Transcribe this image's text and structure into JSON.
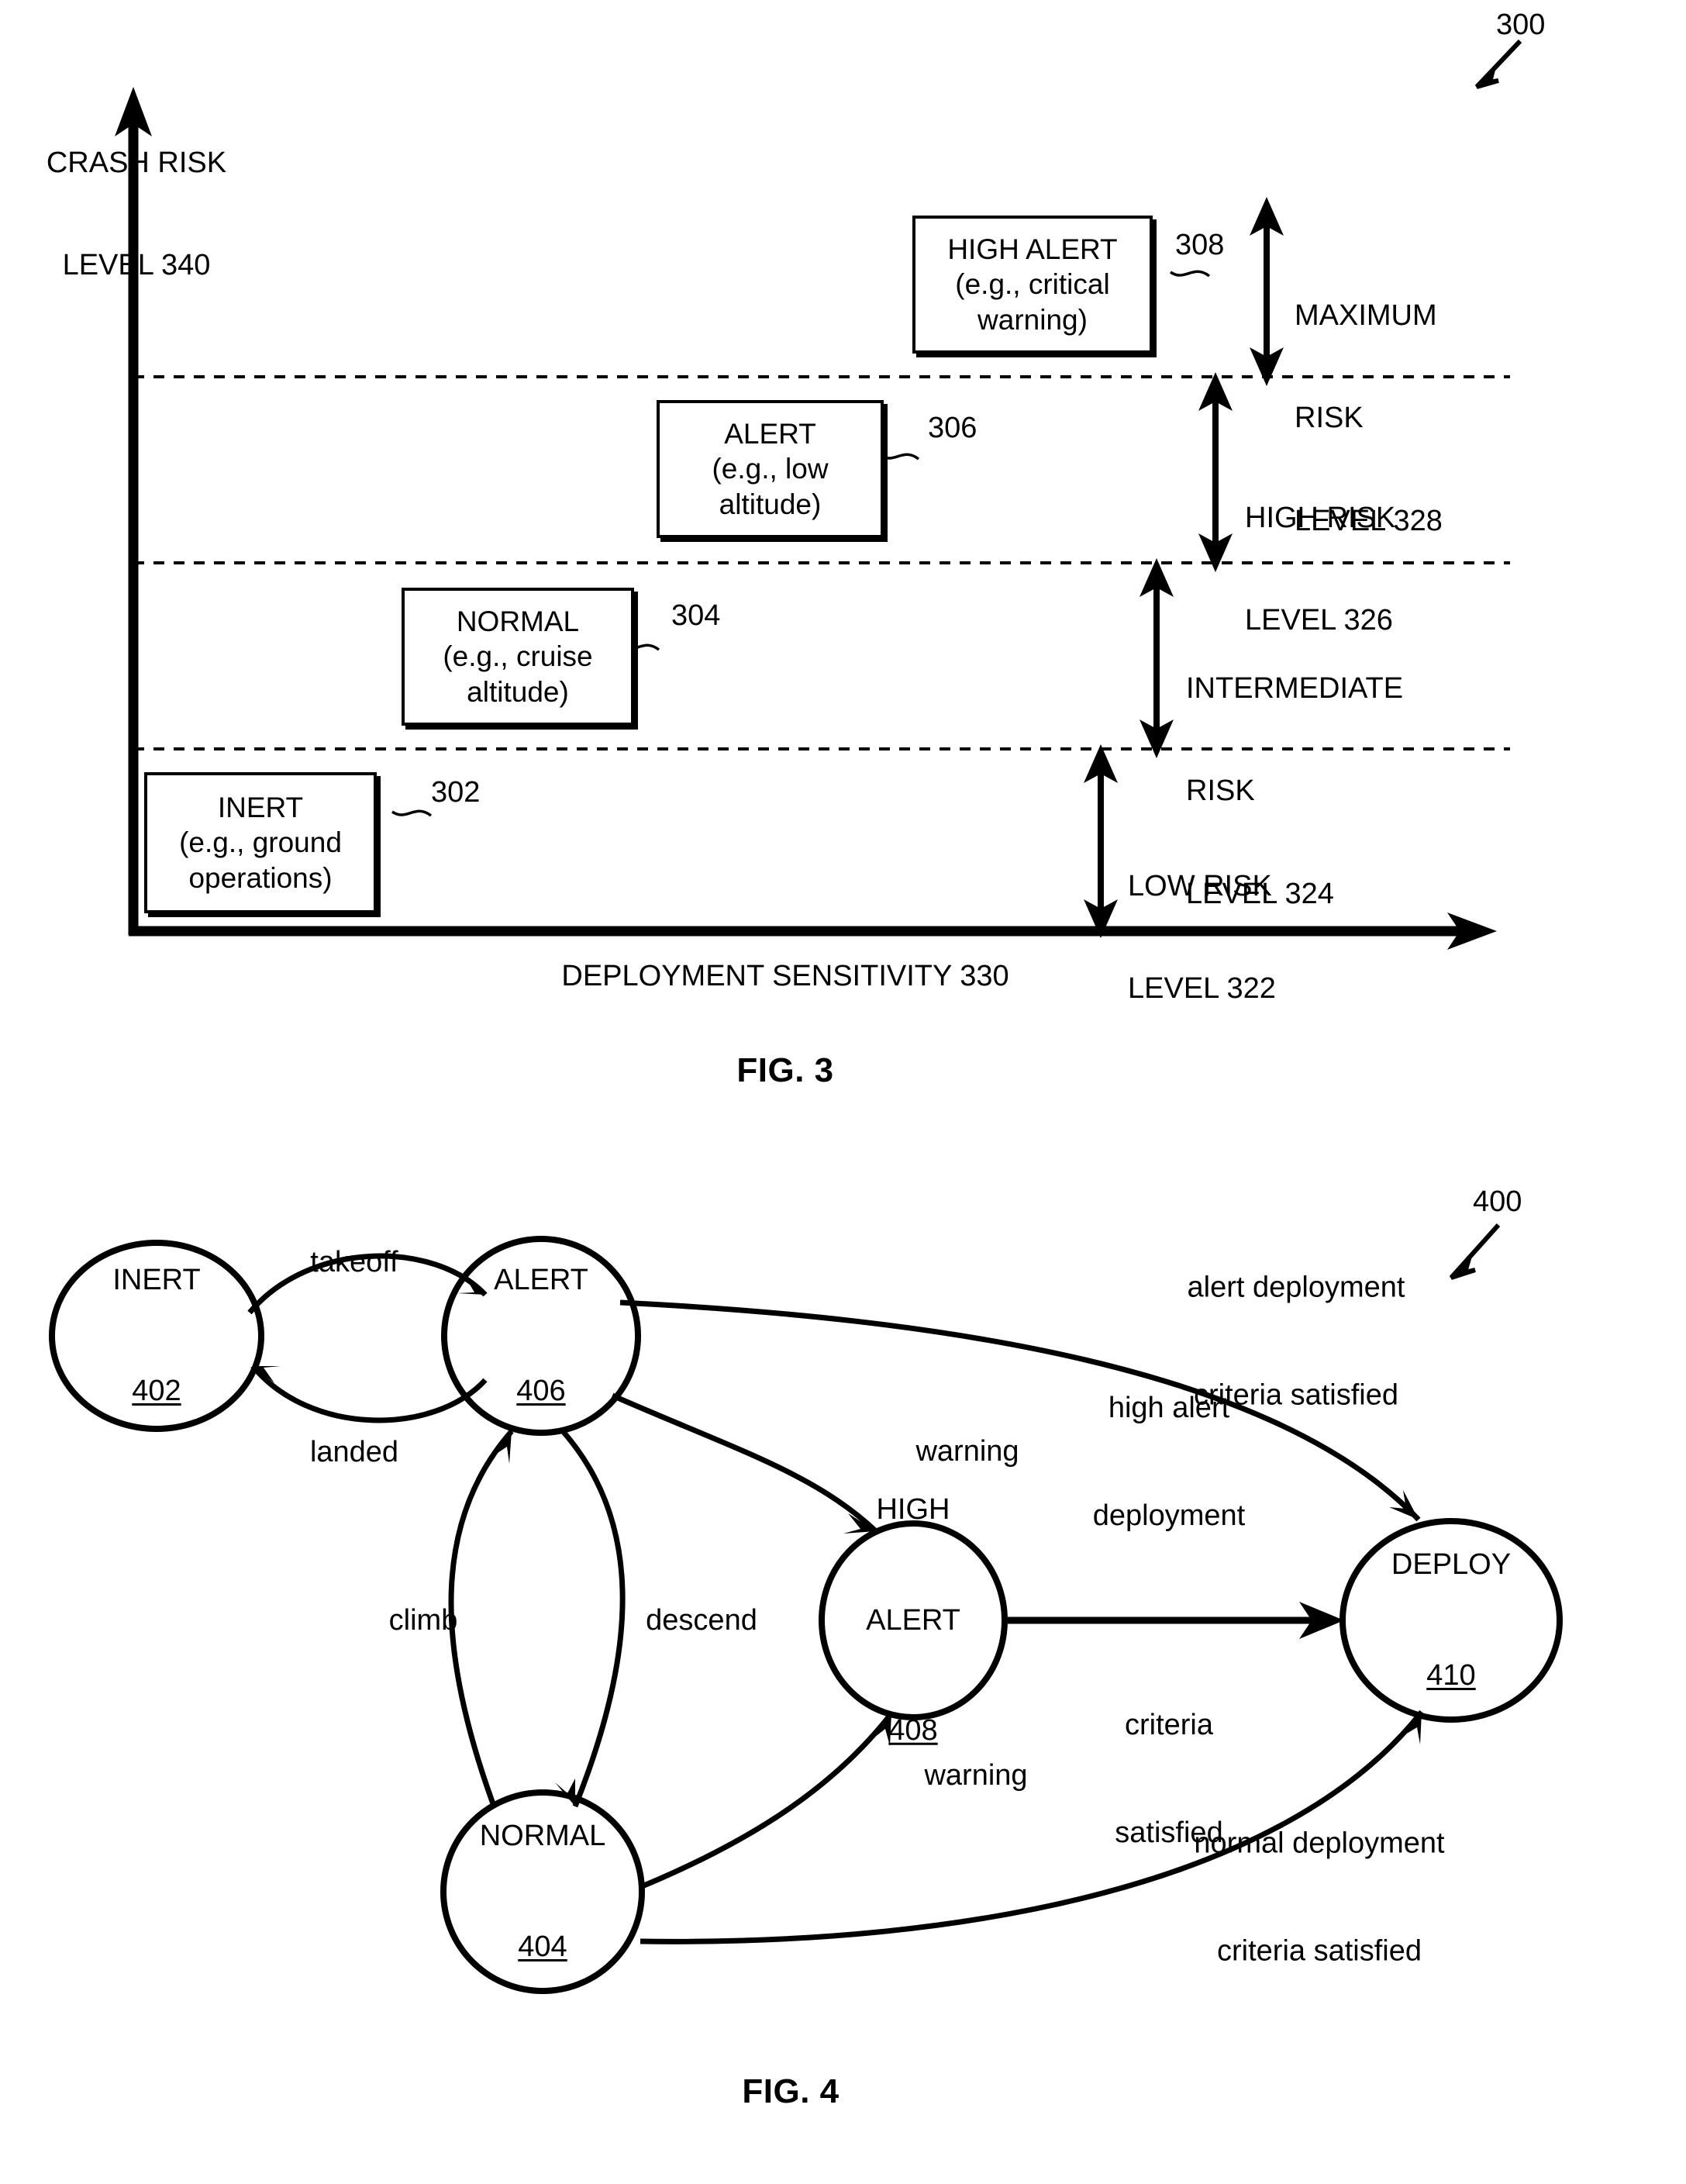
{
  "figure3": {
    "caption": "FIG. 3",
    "ref_number": "300",
    "y_axis_label_line1": "CRASH RISK",
    "y_axis_label_line2": "LEVEL 340",
    "x_axis_label": "DEPLOYMENT SENSITIVITY 330",
    "state_boxes": [
      {
        "id": "inert",
        "line1": "INERT",
        "line2": "(e.g., ground",
        "line3": "operations)",
        "ref": "302"
      },
      {
        "id": "normal",
        "line1": "NORMAL",
        "line2": "(e.g., cruise",
        "line3": "altitude)",
        "ref": "304"
      },
      {
        "id": "alert",
        "line1": "ALERT",
        "line2": "(e.g., low",
        "line3": "altitude)",
        "ref": "306"
      },
      {
        "id": "high-alert",
        "line1": "HIGH ALERT",
        "line2": "(e.g., critical",
        "line3": "warning)",
        "ref": "308"
      }
    ],
    "risk_bands": [
      {
        "id": "low",
        "line1": "LOW RISK",
        "line2": "LEVEL 322",
        "line3": ""
      },
      {
        "id": "intermediate",
        "line1": "INTERMEDIATE",
        "line2": "RISK",
        "line3": "LEVEL 324"
      },
      {
        "id": "high",
        "line1": "HIGH RISK",
        "line2": "LEVEL 326",
        "line3": ""
      },
      {
        "id": "maximum",
        "line1": "MAXIMUM",
        "line2": "RISK",
        "line3": "LEVEL 328"
      }
    ]
  },
  "figure4": {
    "caption": "FIG. 4",
    "ref_number": "400",
    "nodes": [
      {
        "id": "inert",
        "label": "INERT",
        "ref": "402"
      },
      {
        "id": "normal",
        "label": "NORMAL",
        "ref": "404"
      },
      {
        "id": "alert",
        "label": "ALERT",
        "ref": "406"
      },
      {
        "id": "high-alert",
        "label_line1": "HIGH",
        "label_line2": "ALERT",
        "ref": "408"
      },
      {
        "id": "deploy",
        "label": "DEPLOY",
        "ref": "410"
      }
    ],
    "transitions": [
      {
        "id": "takeoff",
        "label": "takeoff",
        "from": "inert",
        "to": "alert"
      },
      {
        "id": "landed",
        "label": "landed",
        "from": "alert",
        "to": "inert"
      },
      {
        "id": "climb",
        "label": "climb",
        "from": "normal",
        "to": "alert"
      },
      {
        "id": "descend",
        "label": "descend",
        "from": "alert",
        "to": "normal"
      },
      {
        "id": "alert-warning",
        "label": "warning",
        "from": "alert",
        "to": "high-alert"
      },
      {
        "id": "normal-warning",
        "label": "warning",
        "from": "normal",
        "to": "high-alert"
      },
      {
        "id": "alert-deploy",
        "label_line1": "alert deployment",
        "label_line2": "criteria satisfied",
        "from": "alert",
        "to": "deploy"
      },
      {
        "id": "high-alert-deploy",
        "label_line1": "high alert",
        "label_line2": "deployment",
        "label_line3": "criteria",
        "label_line4": "satisfied",
        "from": "high-alert",
        "to": "deploy"
      },
      {
        "id": "normal-deploy",
        "label_line1": "normal deployment",
        "label_line2": "criteria satisfied",
        "from": "normal",
        "to": "deploy"
      }
    ]
  }
}
